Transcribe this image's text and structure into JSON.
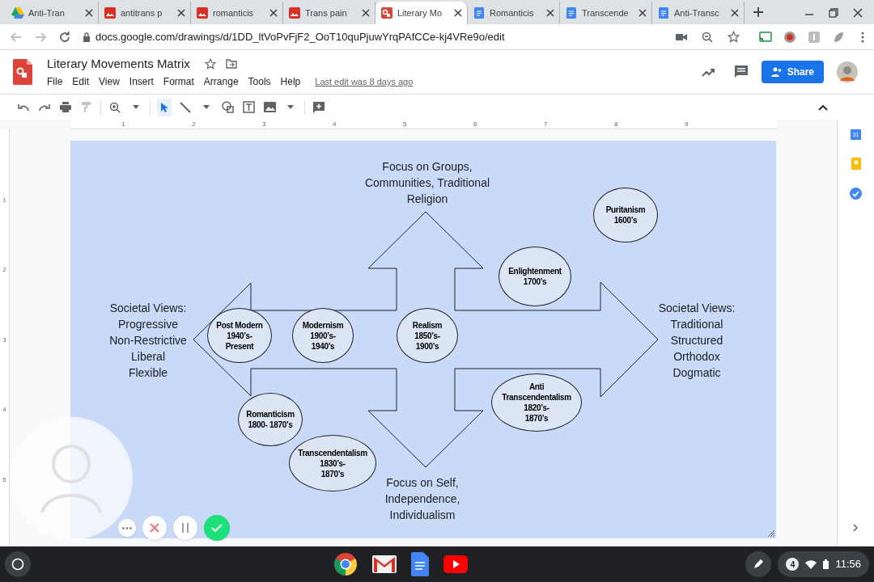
{
  "tabs": [
    {
      "title": "Anti-Tran",
      "kind": "drive",
      "selected": false
    },
    {
      "title": "antitrans p",
      "kind": "image",
      "selected": false
    },
    {
      "title": "romanticis",
      "kind": "image",
      "selected": false
    },
    {
      "title": "Trans pain",
      "kind": "image",
      "selected": false
    },
    {
      "title": "Literary Mo",
      "kind": "drawings",
      "selected": true
    },
    {
      "title": "Romanticis",
      "kind": "docs",
      "selected": false
    },
    {
      "title": "Transcende",
      "kind": "docs",
      "selected": false
    },
    {
      "title": "Anti-Transc",
      "kind": "docs",
      "selected": false
    }
  ],
  "address_bar": {
    "url": "docs.google.com/drawings/d/1DD_ltVoPvFjF2_OoT10quPjuwYrqPAfCCe-kj4VRe9o/edit"
  },
  "document": {
    "title": "Literary Movements Matrix",
    "last_edit": "Last edit was 8 days ago",
    "share_button": "Share"
  },
  "menu": [
    "File",
    "Edit",
    "View",
    "Insert",
    "Format",
    "Arrange",
    "Tools",
    "Help"
  ],
  "ruler": {
    "horizontal": [
      "1",
      "2",
      "3",
      "4",
      "5",
      "6",
      "7",
      "8",
      "9"
    ],
    "vertical": [
      "1",
      "2",
      "3",
      "4",
      "5"
    ]
  },
  "side_panel": {
    "calendar_label": "31"
  },
  "diagram": {
    "labels": [
      {
        "text": "Focus on Groups,\nCommunities, Traditional\nReligion"
      },
      {
        "text": "Societal Views:\nProgressive\nNon-Restrictive\nLiberal\nFlexible"
      },
      {
        "text": "Societal Views:\nTraditional\nStructured\nOrthodox\nDogmatic"
      },
      {
        "text": "Focus on Self,\nIndependence,\nIndividualism"
      }
    ],
    "movements": [
      {
        "text": "Puritanism\n1600’s"
      },
      {
        "text": "Enlightenment\n1700’s"
      },
      {
        "text": "Post Modern\n1940’s-\nPresent"
      },
      {
        "text": "Modernism\n1900’s-\n1940’s"
      },
      {
        "text": "Realism\n1850’s-\n1900’s"
      },
      {
        "text": "Anti\nTranscendentalism\n1820’s-\n1870’s"
      },
      {
        "text": "Romanticism\n1800- 1870’s"
      },
      {
        "text": "Transcendentalism\n1830’s-\n1870’s"
      }
    ]
  },
  "shelf": {
    "notification_count": "4",
    "time": "11:56"
  }
}
